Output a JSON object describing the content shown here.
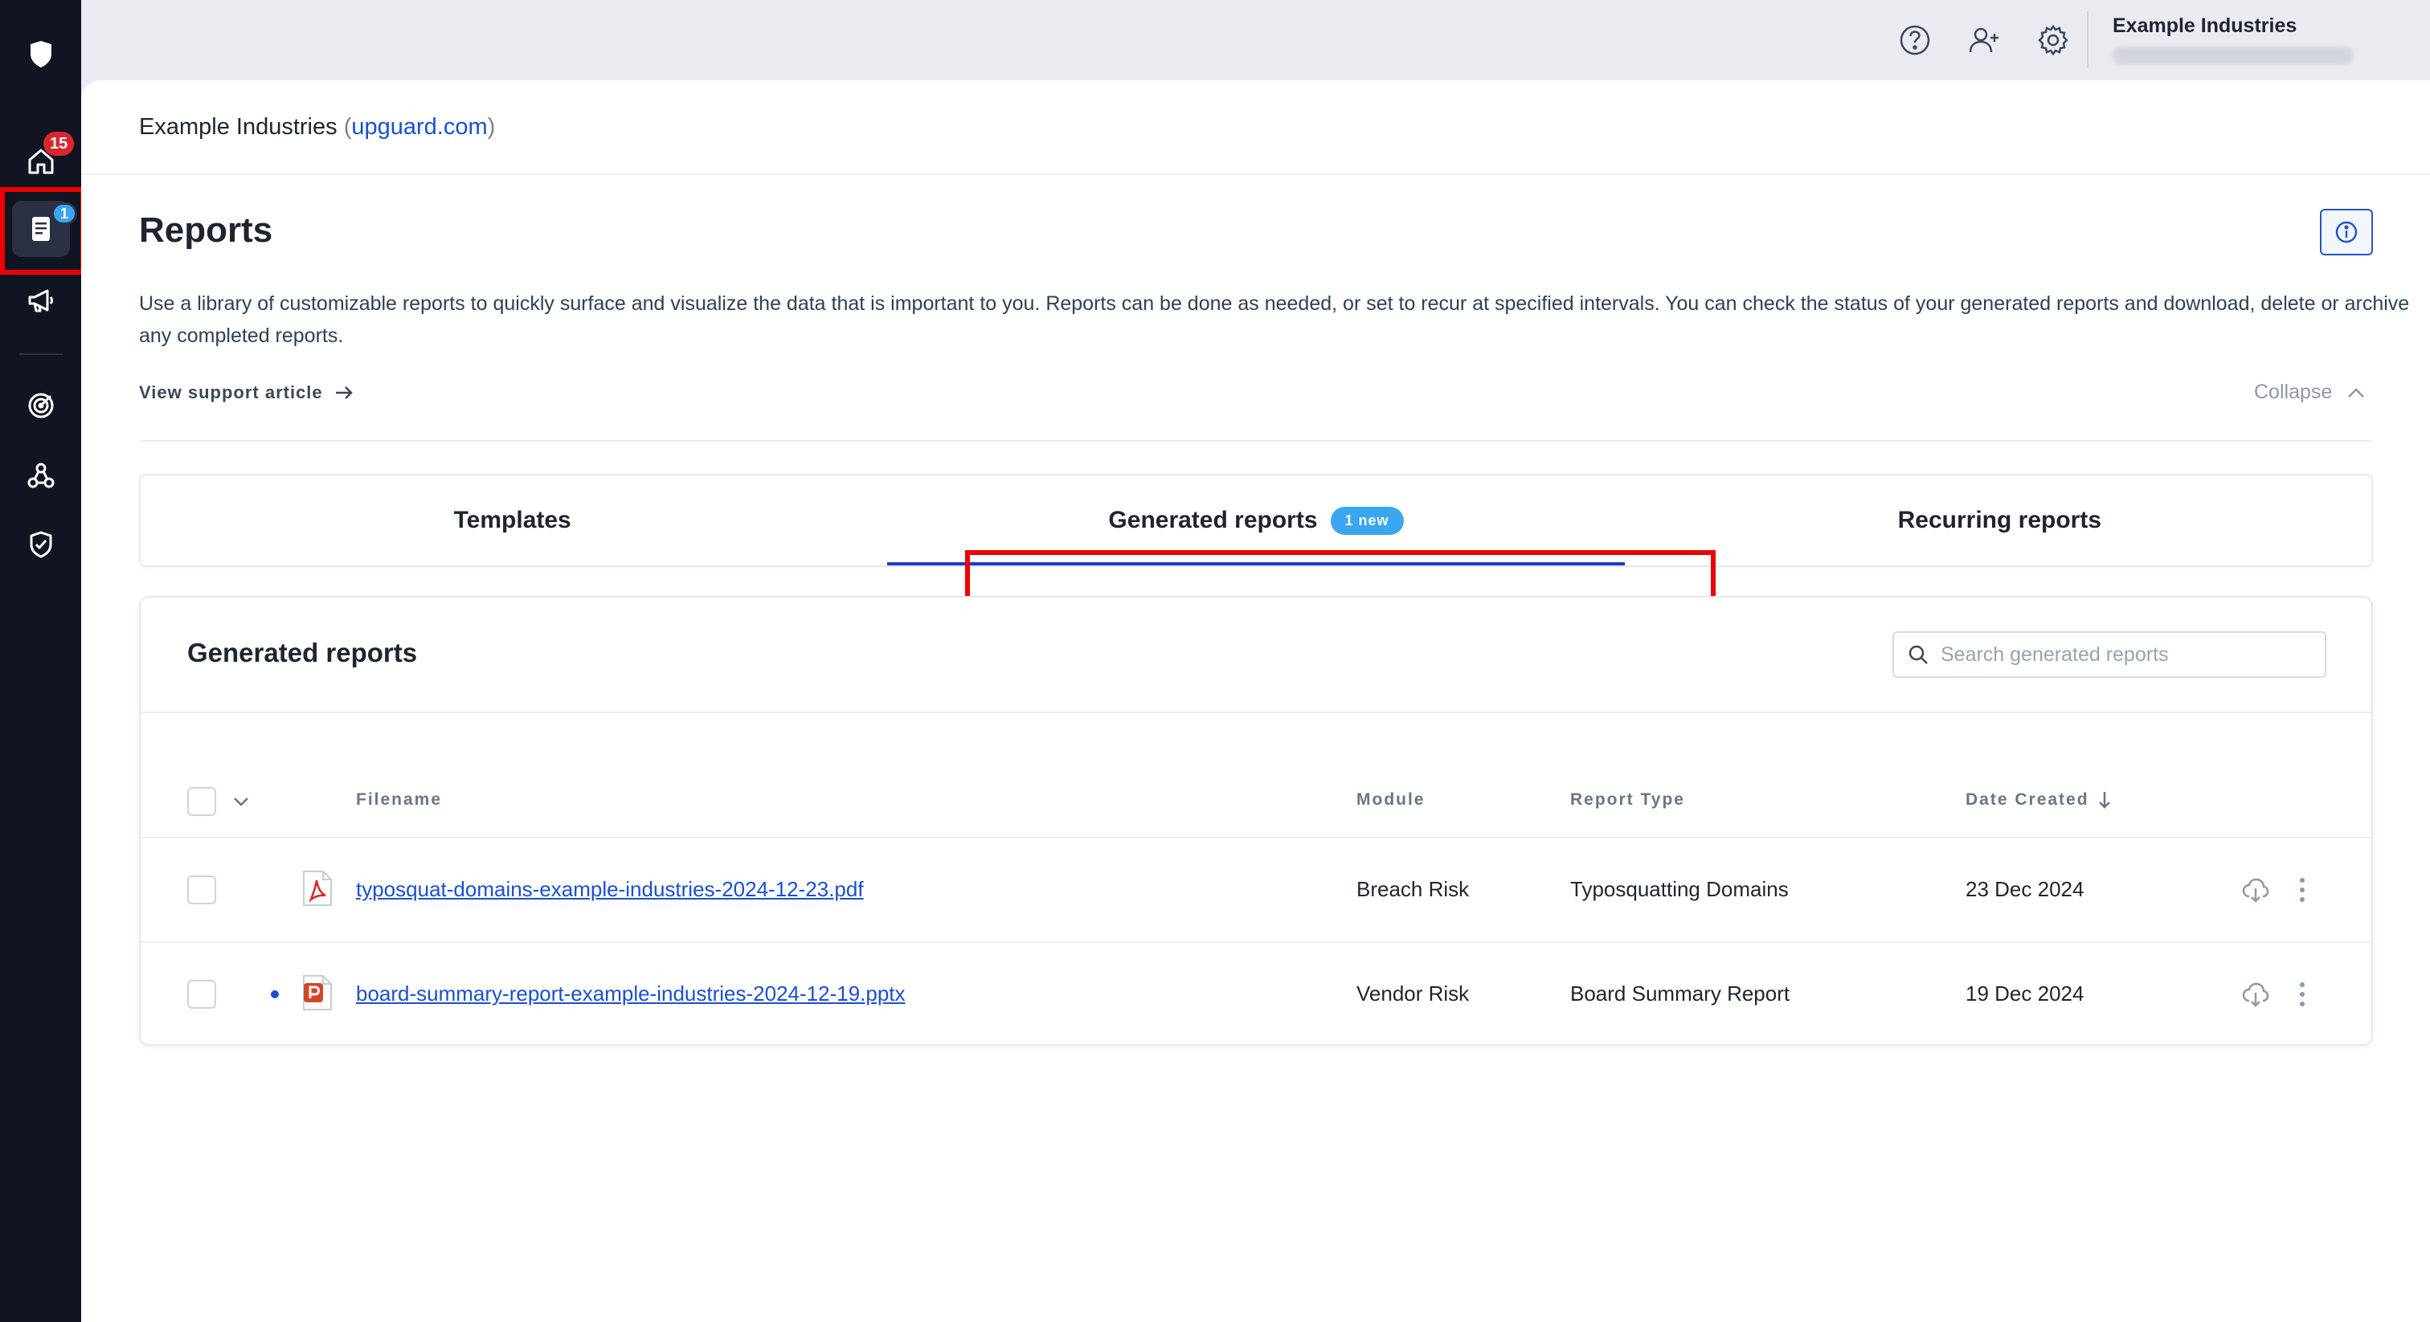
{
  "sidebar": {
    "home_badge": "15",
    "reports_badge": "1"
  },
  "topbar": {
    "org_name": "Example Industries"
  },
  "breadcrumb": {
    "org": "Example Industries",
    "open_paren": "(",
    "domain": "upguard.com",
    "close_paren": ")"
  },
  "page": {
    "title": "Reports",
    "description": "Use a library of customizable reports to quickly surface and visualize the data that is important to you. Reports can be done as needed, or set to recur at specified intervals. You can check the status of your generated reports and download, delete or archive any completed reports.",
    "support_link": "View support article",
    "collapse_label": "Collapse"
  },
  "tabs": [
    {
      "label": "Templates"
    },
    {
      "label": "Generated reports",
      "pill": "1 new"
    },
    {
      "label": "Recurring reports"
    }
  ],
  "card": {
    "title": "Generated reports",
    "search_placeholder": "Search generated reports"
  },
  "table": {
    "columns": {
      "filename": "Filename",
      "module": "Module",
      "report_type": "Report Type",
      "date_created": "Date Created"
    },
    "rows": [
      {
        "filename": "typosquat-domains-example-industries-2024-12-23.pdf",
        "file_type": "pdf",
        "module": "Breach Risk",
        "report_type": "Typosquatting Domains",
        "date_created": "23 Dec 2024",
        "unread": false
      },
      {
        "filename": "board-summary-report-example-industries-2024-12-19.pptx",
        "file_type": "pptx",
        "module": "Vendor Risk",
        "report_type": "Board Summary Report",
        "date_created": "19 Dec 2024",
        "unread": true
      }
    ]
  },
  "colors": {
    "sidebar_bg": "#111522",
    "accent_blue": "#1a4fd0",
    "badge_red": "#d9262b",
    "badge_blue": "#3aa6f0",
    "highlight_red": "#ee0000"
  }
}
